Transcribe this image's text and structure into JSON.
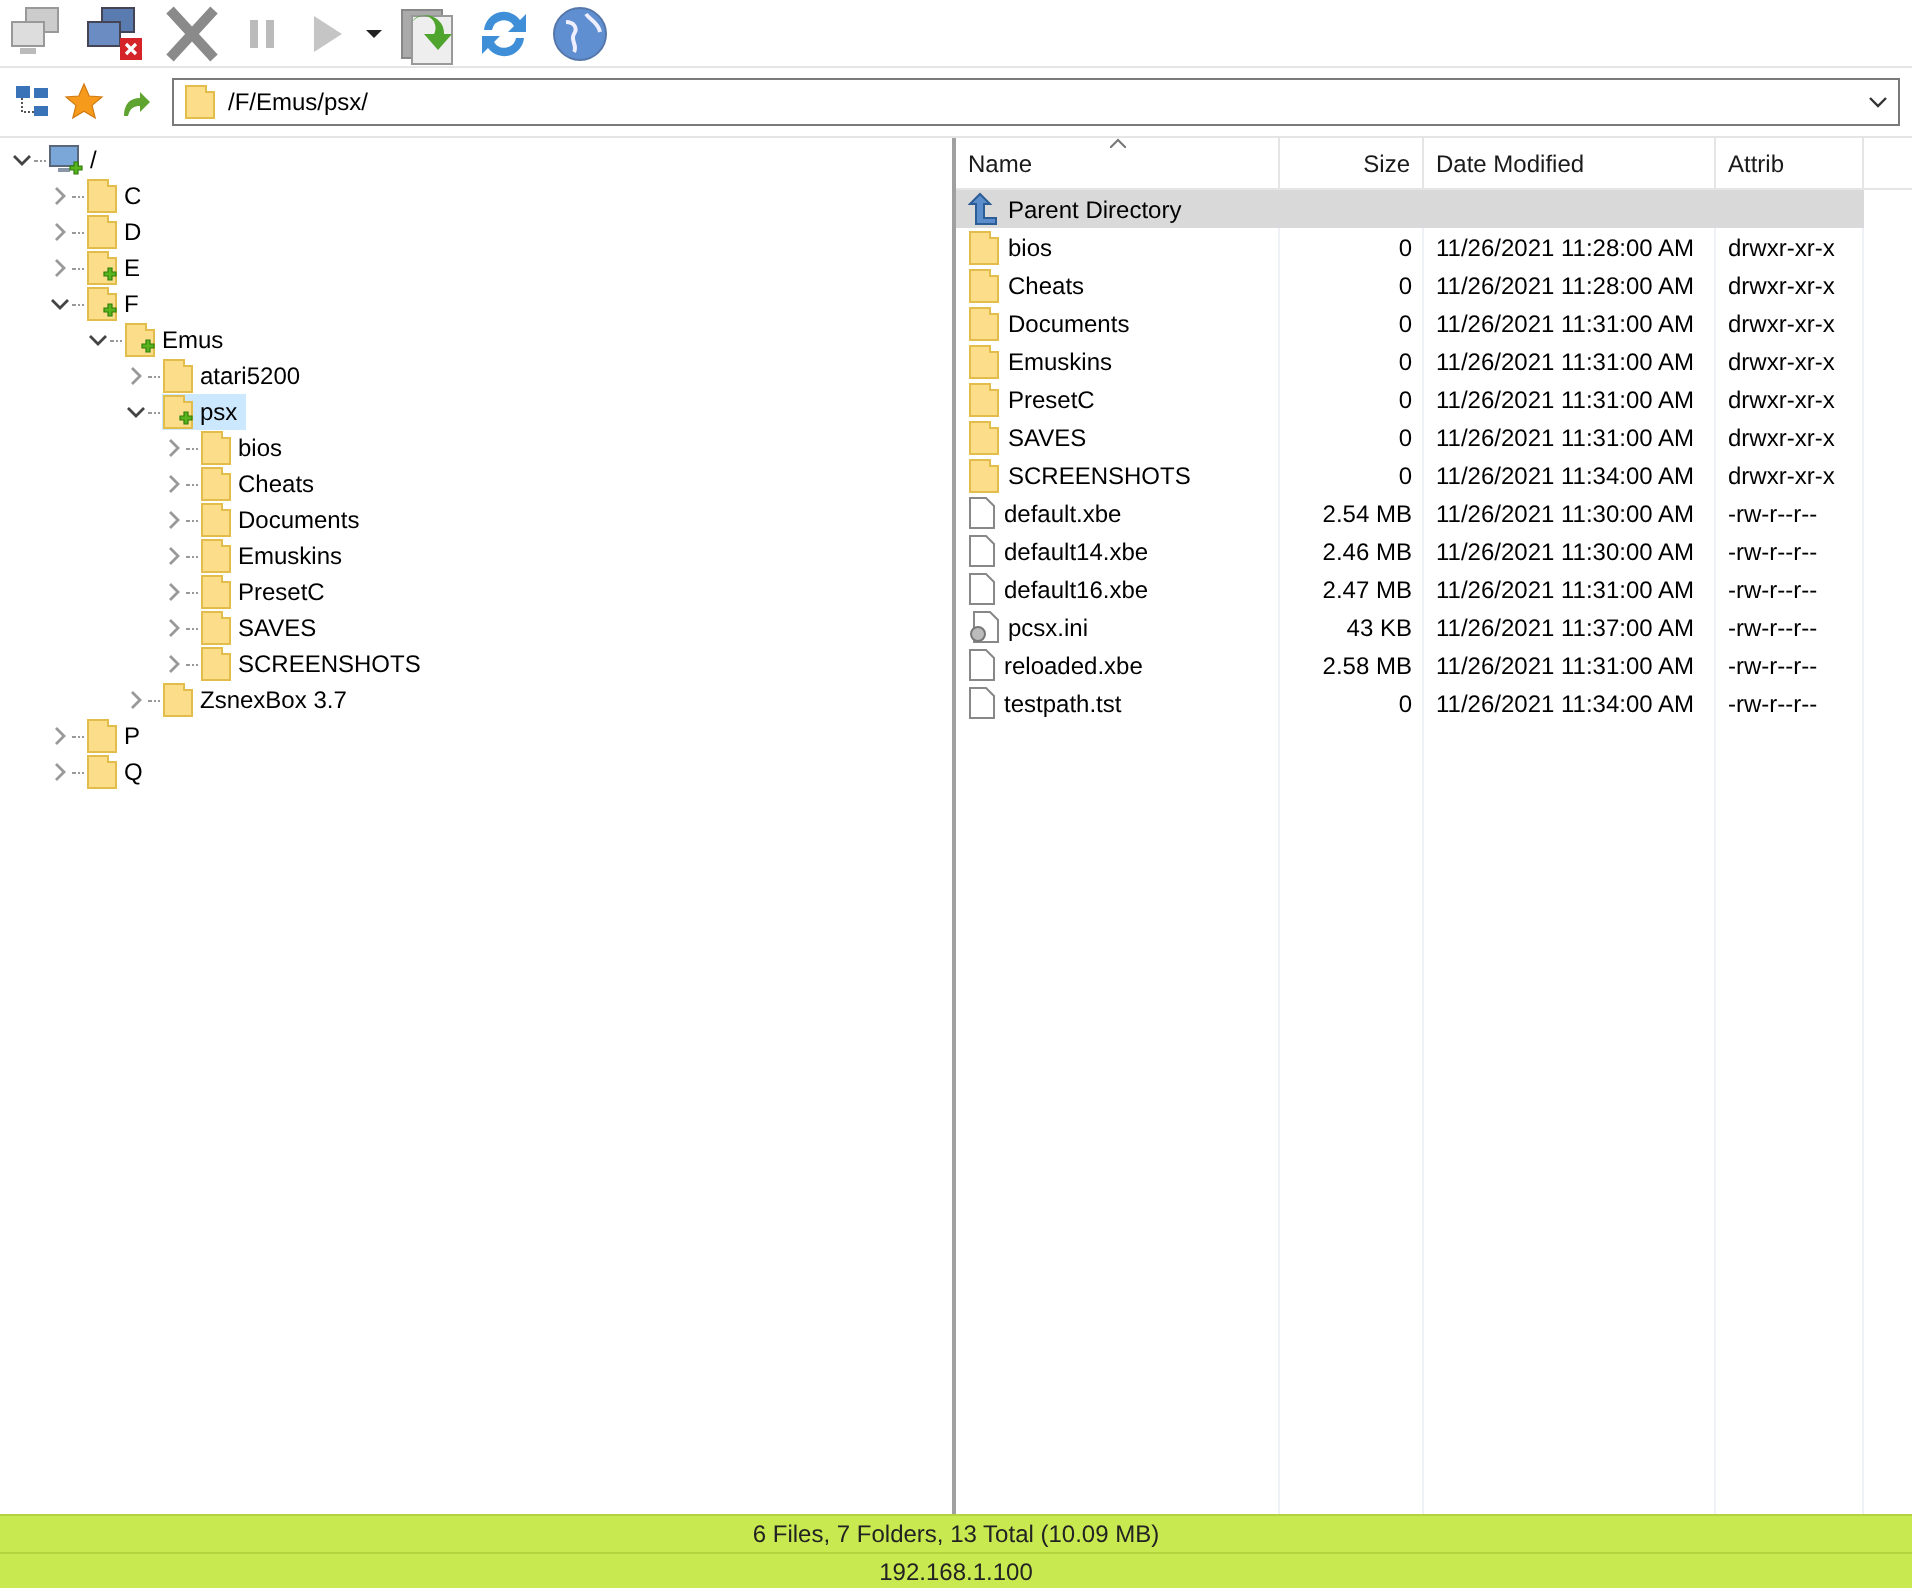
{
  "address_bar": {
    "path": "/F/Emus/psx/"
  },
  "tree": [
    {
      "label": "/",
      "kind": "computer",
      "expanded": true,
      "selected": false,
      "marked": true,
      "children": [
        {
          "label": "C",
          "kind": "folder",
          "expanded": false,
          "selected": false,
          "marked": false
        },
        {
          "label": "D",
          "kind": "folder",
          "expanded": false,
          "selected": false,
          "marked": false
        },
        {
          "label": "E",
          "kind": "folder",
          "expanded": false,
          "selected": false,
          "marked": true
        },
        {
          "label": "F",
          "kind": "folder",
          "expanded": true,
          "selected": false,
          "marked": true,
          "children": [
            {
              "label": "Emus",
              "kind": "folder",
              "expanded": true,
              "selected": false,
              "marked": true,
              "children": [
                {
                  "label": "atari5200",
                  "kind": "folder",
                  "expanded": false,
                  "selected": false,
                  "marked": false
                },
                {
                  "label": "psx",
                  "kind": "folder",
                  "expanded": true,
                  "selected": true,
                  "marked": true,
                  "children": [
                    {
                      "label": "bios",
                      "kind": "folder",
                      "expanded": false,
                      "selected": false,
                      "marked": false
                    },
                    {
                      "label": "Cheats",
                      "kind": "folder",
                      "expanded": false,
                      "selected": false,
                      "marked": false
                    },
                    {
                      "label": "Documents",
                      "kind": "folder",
                      "expanded": false,
                      "selected": false,
                      "marked": false
                    },
                    {
                      "label": "Emuskins",
                      "kind": "folder",
                      "expanded": false,
                      "selected": false,
                      "marked": false
                    },
                    {
                      "label": "PresetC",
                      "kind": "folder",
                      "expanded": false,
                      "selected": false,
                      "marked": false
                    },
                    {
                      "label": "SAVES",
                      "kind": "folder",
                      "expanded": false,
                      "selected": false,
                      "marked": false
                    },
                    {
                      "label": "SCREENSHOTS",
                      "kind": "folder",
                      "expanded": false,
                      "selected": false,
                      "marked": false
                    }
                  ]
                },
                {
                  "label": "ZsnexBox 3.7",
                  "kind": "folder",
                  "expanded": false,
                  "selected": false,
                  "marked": false
                }
              ]
            }
          ]
        },
        {
          "label": "P",
          "kind": "folder",
          "expanded": false,
          "selected": false,
          "marked": false
        },
        {
          "label": "Q",
          "kind": "folder",
          "expanded": false,
          "selected": false,
          "marked": false
        }
      ]
    }
  ],
  "table": {
    "columns": [
      {
        "label": "Name",
        "sorted": true
      },
      {
        "label": "Size",
        "sorted": false
      },
      {
        "label": "Date Modified",
        "sorted": false
      },
      {
        "label": "Attrib",
        "sorted": false
      }
    ],
    "rows": [
      {
        "kind": "parent",
        "name": "Parent Directory",
        "selected": true
      },
      {
        "kind": "folder",
        "name": "bios",
        "size": "0",
        "date": "11/26/2021 11:28:00 AM",
        "attrib": "drwxr-xr-x",
        "selected": false
      },
      {
        "kind": "folder",
        "name": "Cheats",
        "size": "0",
        "date": "11/26/2021 11:28:00 AM",
        "attrib": "drwxr-xr-x",
        "selected": false
      },
      {
        "kind": "folder",
        "name": "Documents",
        "size": "0",
        "date": "11/26/2021 11:31:00 AM",
        "attrib": "drwxr-xr-x",
        "selected": false
      },
      {
        "kind": "folder",
        "name": "Emuskins",
        "size": "0",
        "date": "11/26/2021 11:31:00 AM",
        "attrib": "drwxr-xr-x",
        "selected": false
      },
      {
        "kind": "folder",
        "name": "PresetC",
        "size": "0",
        "date": "11/26/2021 11:31:00 AM",
        "attrib": "drwxr-xr-x",
        "selected": false
      },
      {
        "kind": "folder",
        "name": "SAVES",
        "size": "0",
        "date": "11/26/2021 11:31:00 AM",
        "attrib": "drwxr-xr-x",
        "selected": false
      },
      {
        "kind": "folder",
        "name": "SCREENSHOTS",
        "size": "0",
        "date": "11/26/2021 11:34:00 AM",
        "attrib": "drwxr-xr-x",
        "selected": false
      },
      {
        "kind": "file",
        "name": "default.xbe",
        "size": "2.54 MB",
        "date": "11/26/2021 11:30:00 AM",
        "attrib": "-rw-r--r--",
        "selected": false
      },
      {
        "kind": "file",
        "name": "default14.xbe",
        "size": "2.46 MB",
        "date": "11/26/2021 11:30:00 AM",
        "attrib": "-rw-r--r--",
        "selected": false
      },
      {
        "kind": "file",
        "name": "default16.xbe",
        "size": "2.47 MB",
        "date": "11/26/2021 11:31:00 AM",
        "attrib": "-rw-r--r--",
        "selected": false
      },
      {
        "kind": "settings",
        "name": "pcsx.ini",
        "size": "43 KB",
        "date": "11/26/2021 11:37:00 AM",
        "attrib": "-rw-r--r--",
        "selected": false
      },
      {
        "kind": "file",
        "name": "reloaded.xbe",
        "size": "2.58 MB",
        "date": "11/26/2021 11:31:00 AM",
        "attrib": "-rw-r--r--",
        "selected": false
      },
      {
        "kind": "file",
        "name": "testpath.tst",
        "size": "0",
        "date": "11/26/2021 11:34:00 AM",
        "attrib": "-rw-r--r--",
        "selected": false
      }
    ]
  },
  "status_bar": {
    "summary": "6 Files, 7 Folders, 13 Total (10.09 MB)",
    "host": "192.168.1.100"
  }
}
